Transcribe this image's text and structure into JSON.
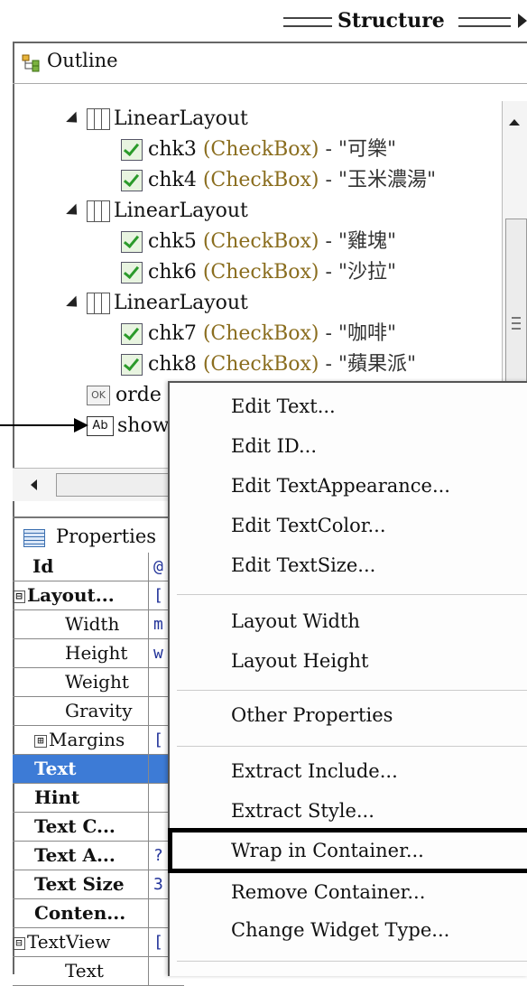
{
  "structure": {
    "title": "Structure"
  },
  "outline": {
    "title": "Outline",
    "tree": [
      {
        "kind": "layout",
        "label": "LinearLayout"
      },
      {
        "kind": "checkbox",
        "id": "chk3",
        "type": "(CheckBox)",
        "text": "- \"可樂\""
      },
      {
        "kind": "checkbox",
        "id": "chk4",
        "type": "(CheckBox)",
        "text": "- \"玉米濃湯\""
      },
      {
        "kind": "layout",
        "label": "LinearLayout"
      },
      {
        "kind": "checkbox",
        "id": "chk5",
        "type": "(CheckBox)",
        "text": "- \"雞塊\""
      },
      {
        "kind": "checkbox",
        "id": "chk6",
        "type": "(CheckBox)",
        "text": "- \"沙拉\""
      },
      {
        "kind": "layout",
        "label": "LinearLayout"
      },
      {
        "kind": "checkbox",
        "id": "chk7",
        "type": "(CheckBox)",
        "text": "- \"咖啡\""
      },
      {
        "kind": "checkbox",
        "id": "chk8",
        "type": "(CheckBox)",
        "text": "- \"蘋果派\""
      },
      {
        "kind": "button",
        "icon": "OK",
        "label": "orde"
      },
      {
        "kind": "textview",
        "icon": "Ab",
        "label": "show"
      }
    ]
  },
  "properties": {
    "title": "Properties",
    "rows": [
      {
        "name": "Id",
        "val": "@"
      },
      {
        "name": "Layout...",
        "val": "[",
        "box": "⊟"
      },
      {
        "name": "Width",
        "val": "m"
      },
      {
        "name": "Height",
        "val": "w"
      },
      {
        "name": "Weight",
        "val": ""
      },
      {
        "name": "Gravity",
        "val": ""
      },
      {
        "name": "Margins",
        "val": "[",
        "box": "⊞"
      },
      {
        "name": "Text",
        "val": ""
      },
      {
        "name": "Hint",
        "val": ""
      },
      {
        "name": "Text C...",
        "val": ""
      },
      {
        "name": "Text A...",
        "val": "?"
      },
      {
        "name": "Text Size",
        "val": "3"
      },
      {
        "name": "Conten...",
        "val": ""
      },
      {
        "name": "TextView",
        "val": "[",
        "box": "⊟"
      },
      {
        "name": "Text",
        "val": ""
      }
    ]
  },
  "menu": {
    "items": [
      "Edit Text...",
      "Edit ID...",
      "Edit TextAppearance...",
      "Edit TextColor...",
      "Edit TextSize...",
      "Layout Width",
      "Layout Height",
      "Other Properties",
      "Extract Include...",
      "Extract Style...",
      "Wrap in Container...",
      "Remove Container...",
      "Change Widget Type..."
    ]
  }
}
